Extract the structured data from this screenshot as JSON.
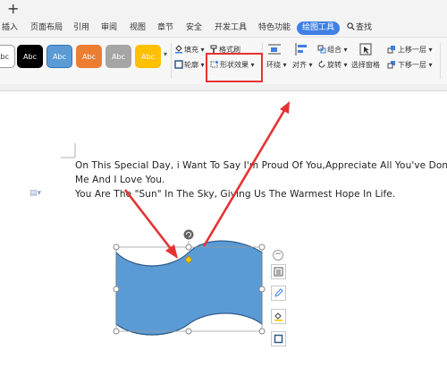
{
  "titlebar": {
    "new_tab": "+"
  },
  "tabs": [
    {
      "label": "插入"
    },
    {
      "label": "页面布局"
    },
    {
      "label": "引用"
    },
    {
      "label": "审阅"
    },
    {
      "label": "视图"
    },
    {
      "label": "章节"
    },
    {
      "label": "安全"
    },
    {
      "label": "开发工具"
    },
    {
      "label": "特色功能"
    },
    {
      "label": "绘图工具"
    }
  ],
  "search": {
    "label": "查找"
  },
  "styles": [
    {
      "label": "Abc",
      "bg": "#ffffff",
      "fg": "#333333",
      "border": "#999999"
    },
    {
      "label": "Abc",
      "bg": "#000000",
      "fg": "#ffffff",
      "border": "#000000"
    },
    {
      "label": "Abc",
      "bg": "#5b9bd5",
      "fg": "#ffffff",
      "border": "#2e75b6"
    },
    {
      "label": "Abc",
      "bg": "#ed7d31",
      "fg": "#ffffff",
      "border": "#ed7d31"
    },
    {
      "label": "Abc",
      "bg": "#a5a5a5",
      "fg": "#ffffff",
      "border": "#a5a5a5"
    },
    {
      "label": "Abc",
      "bg": "#ffc000",
      "fg": "#ffffff",
      "border": "#ffc000"
    }
  ],
  "ribbon": {
    "fill": "填充",
    "format_painter": "格式刷",
    "outline": "轮廓",
    "shape_effects": "形状效果",
    "wrap": "环绕",
    "align": "对齐",
    "group": "组合",
    "rotate": "旋转",
    "selection_pane": "选择窗格",
    "bring_forward": "上移一层",
    "send_backward": "下移一层"
  },
  "document": {
    "line1": "On This Special Day, i Want To Say I'm Proud Of You,Appreciate All You've Done For",
    "line2": "Me And I Love You.",
    "line3": "You Are The \"Sun\" In The Sky, Giving Us The Warmest Hope In Life."
  },
  "colors": {
    "accent": "#3f7fe6",
    "highlight": "#e53333",
    "shape_fill": "#5b9bd5",
    "shape_stroke": "#2e5c8a"
  }
}
